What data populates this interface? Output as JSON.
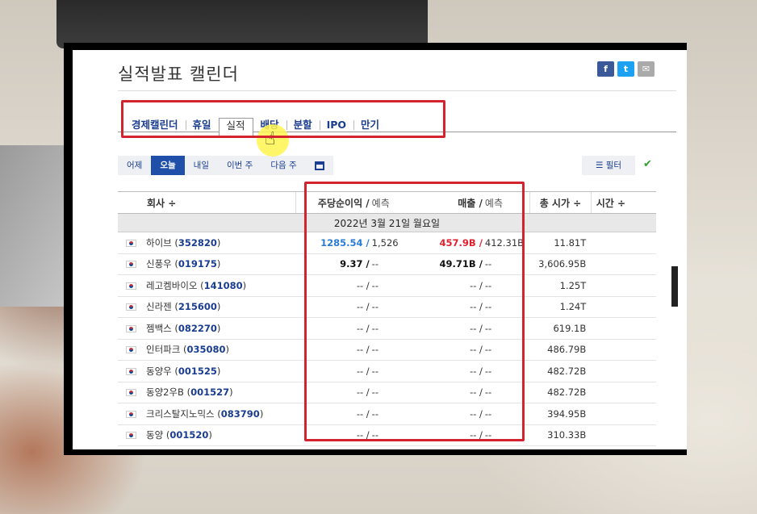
{
  "page": {
    "title": "실적발표 캘린더",
    "share": {
      "facebook": "f",
      "twitter": "t",
      "mail": "✉"
    }
  },
  "tabs": [
    {
      "label": "경제캘린더",
      "active": false
    },
    {
      "label": "휴일",
      "active": false
    },
    {
      "label": "실적",
      "active": true
    },
    {
      "label": "배당",
      "active": false
    },
    {
      "label": "분할",
      "active": false
    },
    {
      "label": "IPO",
      "active": false
    },
    {
      "label": "만기",
      "active": false
    }
  ],
  "days": [
    {
      "label": "어제",
      "active": false
    },
    {
      "label": "오늘",
      "active": true
    },
    {
      "label": "내일",
      "active": false
    },
    {
      "label": "이번 주",
      "active": false
    },
    {
      "label": "다음 주",
      "active": false
    }
  ],
  "filter": {
    "label": "필터",
    "icon": "sliders-icon"
  },
  "table": {
    "headers": {
      "company": "회사 ÷",
      "eps": "주당순이익 /",
      "eps_forecast": "예측",
      "revenue": "매출 /",
      "revenue_forecast": "예측",
      "market_cap": "총 시가 ÷",
      "time": "시간 ÷"
    },
    "date": "2022년 3월 21일 월요일",
    "rows": [
      {
        "name": "하이브",
        "code": "352820",
        "eps": "1285.54 /",
        "eps_f": "1,526",
        "rev": "457.9B /",
        "rev_f": "412.31B",
        "cap": "11.81T",
        "eps_style": "blue",
        "rev_style": "red"
      },
      {
        "name": "신풍우",
        "code": "019175",
        "eps": "9.37 /",
        "eps_f": "--",
        "rev": "49.71B /",
        "rev_f": "--",
        "cap": "3,606.95B",
        "eps_style": "bold",
        "rev_style": "bold"
      },
      {
        "name": "레고켐바이오",
        "code": "141080",
        "eps": "-- /",
        "eps_f": "--",
        "rev": "-- /",
        "rev_f": "--",
        "cap": "1.25T",
        "eps_style": "",
        "rev_style": ""
      },
      {
        "name": "신라젠",
        "code": "215600",
        "eps": "-- /",
        "eps_f": "--",
        "rev": "-- /",
        "rev_f": "--",
        "cap": "1.24T",
        "eps_style": "",
        "rev_style": ""
      },
      {
        "name": "젬백스",
        "code": "082270",
        "eps": "-- /",
        "eps_f": "--",
        "rev": "-- /",
        "rev_f": "--",
        "cap": "619.1B",
        "eps_style": "",
        "rev_style": ""
      },
      {
        "name": "인터파크",
        "code": "035080",
        "eps": "-- /",
        "eps_f": "--",
        "rev": "-- /",
        "rev_f": "--",
        "cap": "486.79B",
        "eps_style": "",
        "rev_style": ""
      },
      {
        "name": "동양우",
        "code": "001525",
        "eps": "-- /",
        "eps_f": "--",
        "rev": "-- /",
        "rev_f": "--",
        "cap": "482.72B",
        "eps_style": "",
        "rev_style": ""
      },
      {
        "name": "동양2우B",
        "code": "001527",
        "eps": "-- /",
        "eps_f": "--",
        "rev": "-- /",
        "rev_f": "--",
        "cap": "482.72B",
        "eps_style": "",
        "rev_style": ""
      },
      {
        "name": "크리스탈지노믹스",
        "code": "083790",
        "eps": "-- /",
        "eps_f": "--",
        "rev": "-- /",
        "rev_f": "--",
        "cap": "394.95B",
        "eps_style": "",
        "rev_style": ""
      },
      {
        "name": "동양",
        "code": "001520",
        "eps": "-- /",
        "eps_f": "--",
        "rev": "-- /",
        "rev_f": "--",
        "cap": "310.33B",
        "eps_style": "",
        "rev_style": ""
      }
    ]
  },
  "colors": {
    "highlight": "#d3232e",
    "brand_blue": "#1a3d8f",
    "active_day": "#1f4fa8",
    "positive": "#2a7bd6",
    "negative": "#e0202e"
  }
}
